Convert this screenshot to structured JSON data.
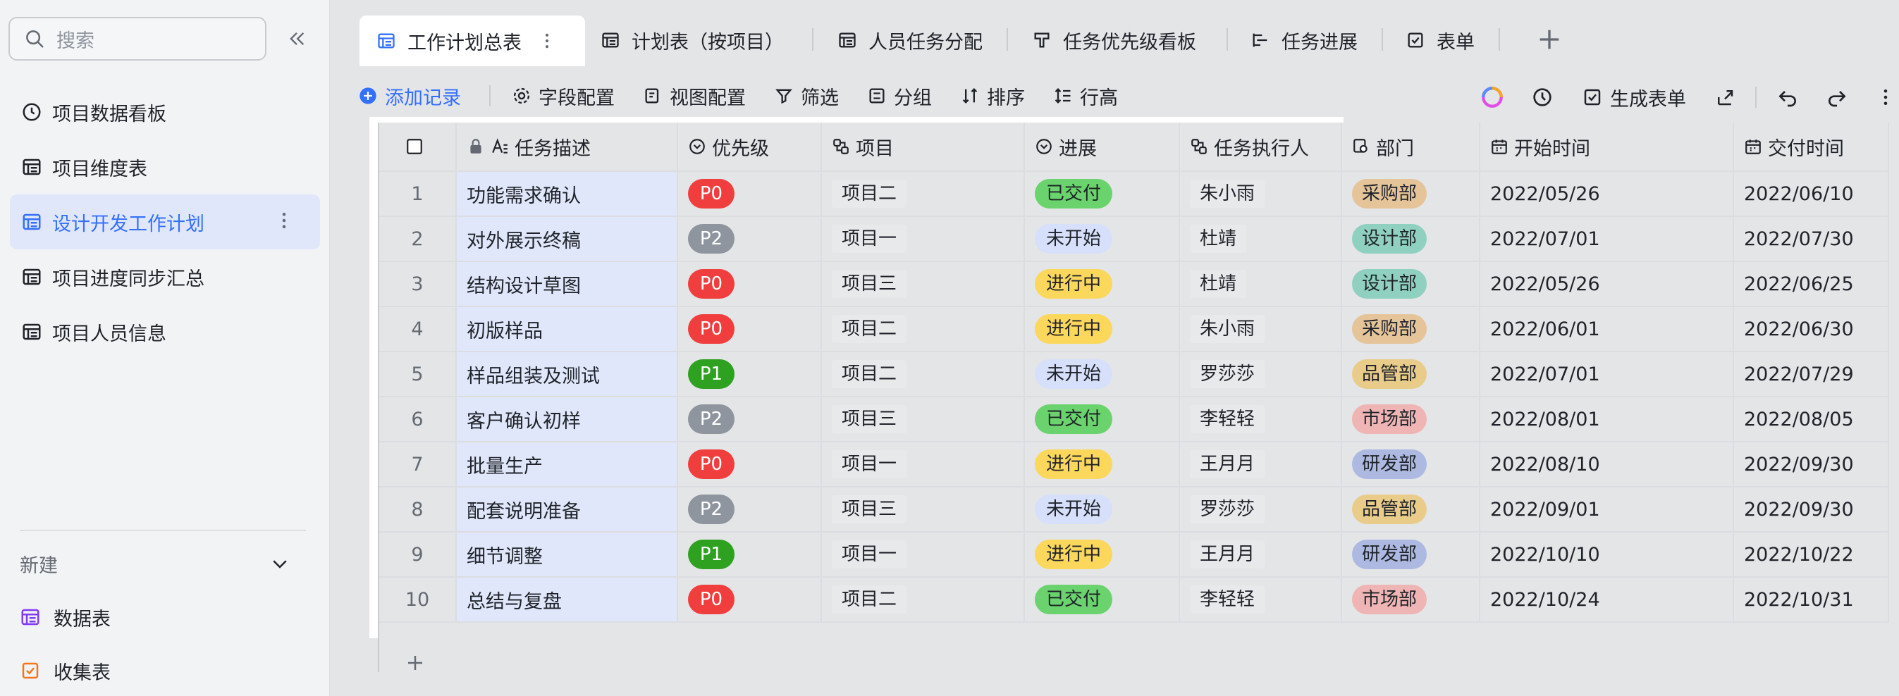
{
  "sidebar": {
    "search_placeholder": "搜索",
    "items": [
      {
        "label": "项目数据看板",
        "icon": "dashboard-icon"
      },
      {
        "label": "项目维度表",
        "icon": "table-icon"
      },
      {
        "label": "设计开发工作计划",
        "icon": "table-icon",
        "active": true
      },
      {
        "label": "项目进度同步汇总",
        "icon": "table-icon"
      },
      {
        "label": "项目人员信息",
        "icon": "table-icon"
      }
    ],
    "new_label": "新建",
    "new_items": [
      {
        "label": "数据表",
        "icon": "table-icon",
        "color": "#7f3bf5"
      },
      {
        "label": "收集表",
        "icon": "form-icon",
        "color": "#f5761a"
      }
    ]
  },
  "tabs": [
    {
      "label": "工作计划总表",
      "active": true
    },
    {
      "label": "计划表（按项目）"
    },
    {
      "label": "人员任务分配"
    },
    {
      "label": "任务优先级看板"
    },
    {
      "label": "任务进展"
    },
    {
      "label": "表单"
    }
  ],
  "toolbar": {
    "add": "添加记录",
    "fields": "字段配置",
    "view": "视图配置",
    "filter": "筛选",
    "group": "分组",
    "sort": "排序",
    "row_height": "行高",
    "generate_form": "生成表单"
  },
  "columns": [
    "任务描述",
    "优先级",
    "项目",
    "进展",
    "任务执行人",
    "部门",
    "开始时间",
    "交付时间"
  ],
  "colors": {
    "P0": "#f03e3e",
    "P1": "#2ea121",
    "P2": "#8f959e",
    "已交付": "#6bd36d",
    "未开始": "#d6e0fb",
    "进行中": "#fbd75c",
    "采购部": "#e5c49a",
    "设计部": "#8fd0c0",
    "品管部": "#e9cc8a",
    "市场部": "#efb4b4",
    "研发部": "#aeb9e2",
    "accent": "#3370ff"
  },
  "rows": [
    {
      "n": "1",
      "desc": "功能需求确认",
      "prio": "P0",
      "proj": "项目二",
      "status": "已交付",
      "owner": "朱小雨",
      "dept": "采购部",
      "start": "2022/05/26",
      "due": "2022/06/10"
    },
    {
      "n": "2",
      "desc": "对外展示终稿",
      "prio": "P2",
      "proj": "项目一",
      "status": "未开始",
      "owner": "杜靖",
      "dept": "设计部",
      "start": "2022/07/01",
      "due": "2022/07/30"
    },
    {
      "n": "3",
      "desc": "结构设计草图",
      "prio": "P0",
      "proj": "项目三",
      "status": "进行中",
      "owner": "杜靖",
      "dept": "设计部",
      "start": "2022/05/26",
      "due": "2022/06/25"
    },
    {
      "n": "4",
      "desc": "初版样品",
      "prio": "P0",
      "proj": "项目二",
      "status": "进行中",
      "owner": "朱小雨",
      "dept": "采购部",
      "start": "2022/06/01",
      "due": "2022/06/30"
    },
    {
      "n": "5",
      "desc": "样品组装及测试",
      "prio": "P1",
      "proj": "项目二",
      "status": "未开始",
      "owner": "罗莎莎",
      "dept": "品管部",
      "start": "2022/07/01",
      "due": "2022/07/29"
    },
    {
      "n": "6",
      "desc": "客户确认初样",
      "prio": "P2",
      "proj": "项目三",
      "status": "已交付",
      "owner": "李轻轻",
      "dept": "市场部",
      "start": "2022/08/01",
      "due": "2022/08/05"
    },
    {
      "n": "7",
      "desc": "批量生产",
      "prio": "P0",
      "proj": "项目一",
      "status": "进行中",
      "owner": "王月月",
      "dept": "研发部",
      "start": "2022/08/10",
      "due": "2022/09/30"
    },
    {
      "n": "8",
      "desc": "配套说明准备",
      "prio": "P2",
      "proj": "项目三",
      "status": "未开始",
      "owner": "罗莎莎",
      "dept": "品管部",
      "start": "2022/09/01",
      "due": "2022/09/30"
    },
    {
      "n": "9",
      "desc": "细节调整",
      "prio": "P1",
      "proj": "项目一",
      "status": "进行中",
      "owner": "王月月",
      "dept": "研发部",
      "start": "2022/10/10",
      "due": "2022/10/22"
    },
    {
      "n": "10",
      "desc": "总结与复盘",
      "prio": "P0",
      "proj": "项目二",
      "status": "已交付",
      "owner": "李轻轻",
      "dept": "市场部",
      "start": "2022/10/24",
      "due": "2022/10/31"
    }
  ]
}
